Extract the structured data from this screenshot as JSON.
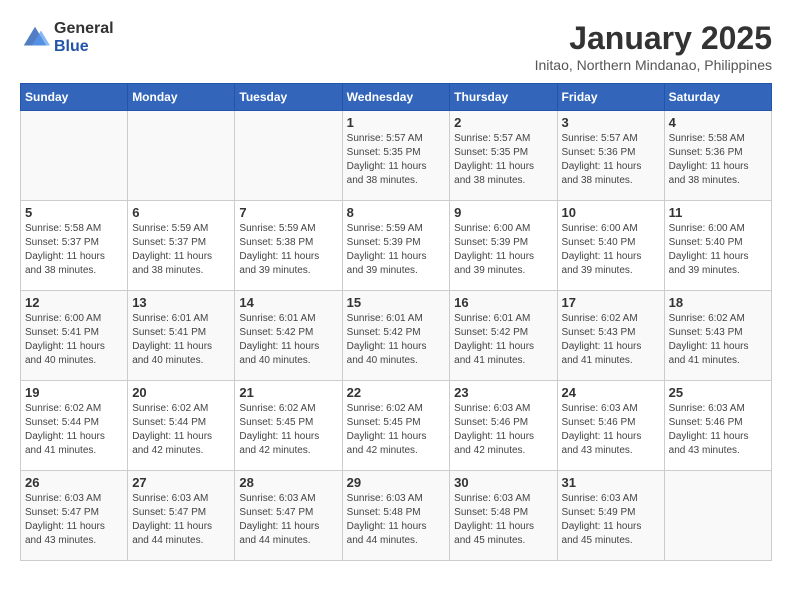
{
  "logo": {
    "general": "General",
    "blue": "Blue"
  },
  "title": "January 2025",
  "subtitle": "Initao, Northern Mindanao, Philippines",
  "days_of_week": [
    "Sunday",
    "Monday",
    "Tuesday",
    "Wednesday",
    "Thursday",
    "Friday",
    "Saturday"
  ],
  "weeks": [
    [
      {
        "day": "",
        "sunrise": "",
        "sunset": "",
        "daylight": ""
      },
      {
        "day": "",
        "sunrise": "",
        "sunset": "",
        "daylight": ""
      },
      {
        "day": "",
        "sunrise": "",
        "sunset": "",
        "daylight": ""
      },
      {
        "day": "1",
        "sunrise": "Sunrise: 5:57 AM",
        "sunset": "Sunset: 5:35 PM",
        "daylight": "Daylight: 11 hours and 38 minutes."
      },
      {
        "day": "2",
        "sunrise": "Sunrise: 5:57 AM",
        "sunset": "Sunset: 5:35 PM",
        "daylight": "Daylight: 11 hours and 38 minutes."
      },
      {
        "day": "3",
        "sunrise": "Sunrise: 5:57 AM",
        "sunset": "Sunset: 5:36 PM",
        "daylight": "Daylight: 11 hours and 38 minutes."
      },
      {
        "day": "4",
        "sunrise": "Sunrise: 5:58 AM",
        "sunset": "Sunset: 5:36 PM",
        "daylight": "Daylight: 11 hours and 38 minutes."
      }
    ],
    [
      {
        "day": "5",
        "sunrise": "Sunrise: 5:58 AM",
        "sunset": "Sunset: 5:37 PM",
        "daylight": "Daylight: 11 hours and 38 minutes."
      },
      {
        "day": "6",
        "sunrise": "Sunrise: 5:59 AM",
        "sunset": "Sunset: 5:37 PM",
        "daylight": "Daylight: 11 hours and 38 minutes."
      },
      {
        "day": "7",
        "sunrise": "Sunrise: 5:59 AM",
        "sunset": "Sunset: 5:38 PM",
        "daylight": "Daylight: 11 hours and 39 minutes."
      },
      {
        "day": "8",
        "sunrise": "Sunrise: 5:59 AM",
        "sunset": "Sunset: 5:39 PM",
        "daylight": "Daylight: 11 hours and 39 minutes."
      },
      {
        "day": "9",
        "sunrise": "Sunrise: 6:00 AM",
        "sunset": "Sunset: 5:39 PM",
        "daylight": "Daylight: 11 hours and 39 minutes."
      },
      {
        "day": "10",
        "sunrise": "Sunrise: 6:00 AM",
        "sunset": "Sunset: 5:40 PM",
        "daylight": "Daylight: 11 hours and 39 minutes."
      },
      {
        "day": "11",
        "sunrise": "Sunrise: 6:00 AM",
        "sunset": "Sunset: 5:40 PM",
        "daylight": "Daylight: 11 hours and 39 minutes."
      }
    ],
    [
      {
        "day": "12",
        "sunrise": "Sunrise: 6:00 AM",
        "sunset": "Sunset: 5:41 PM",
        "daylight": "Daylight: 11 hours and 40 minutes."
      },
      {
        "day": "13",
        "sunrise": "Sunrise: 6:01 AM",
        "sunset": "Sunset: 5:41 PM",
        "daylight": "Daylight: 11 hours and 40 minutes."
      },
      {
        "day": "14",
        "sunrise": "Sunrise: 6:01 AM",
        "sunset": "Sunset: 5:42 PM",
        "daylight": "Daylight: 11 hours and 40 minutes."
      },
      {
        "day": "15",
        "sunrise": "Sunrise: 6:01 AM",
        "sunset": "Sunset: 5:42 PM",
        "daylight": "Daylight: 11 hours and 40 minutes."
      },
      {
        "day": "16",
        "sunrise": "Sunrise: 6:01 AM",
        "sunset": "Sunset: 5:42 PM",
        "daylight": "Daylight: 11 hours and 41 minutes."
      },
      {
        "day": "17",
        "sunrise": "Sunrise: 6:02 AM",
        "sunset": "Sunset: 5:43 PM",
        "daylight": "Daylight: 11 hours and 41 minutes."
      },
      {
        "day": "18",
        "sunrise": "Sunrise: 6:02 AM",
        "sunset": "Sunset: 5:43 PM",
        "daylight": "Daylight: 11 hours and 41 minutes."
      }
    ],
    [
      {
        "day": "19",
        "sunrise": "Sunrise: 6:02 AM",
        "sunset": "Sunset: 5:44 PM",
        "daylight": "Daylight: 11 hours and 41 minutes."
      },
      {
        "day": "20",
        "sunrise": "Sunrise: 6:02 AM",
        "sunset": "Sunset: 5:44 PM",
        "daylight": "Daylight: 11 hours and 42 minutes."
      },
      {
        "day": "21",
        "sunrise": "Sunrise: 6:02 AM",
        "sunset": "Sunset: 5:45 PM",
        "daylight": "Daylight: 11 hours and 42 minutes."
      },
      {
        "day": "22",
        "sunrise": "Sunrise: 6:02 AM",
        "sunset": "Sunset: 5:45 PM",
        "daylight": "Daylight: 11 hours and 42 minutes."
      },
      {
        "day": "23",
        "sunrise": "Sunrise: 6:03 AM",
        "sunset": "Sunset: 5:46 PM",
        "daylight": "Daylight: 11 hours and 42 minutes."
      },
      {
        "day": "24",
        "sunrise": "Sunrise: 6:03 AM",
        "sunset": "Sunset: 5:46 PM",
        "daylight": "Daylight: 11 hours and 43 minutes."
      },
      {
        "day": "25",
        "sunrise": "Sunrise: 6:03 AM",
        "sunset": "Sunset: 5:46 PM",
        "daylight": "Daylight: 11 hours and 43 minutes."
      }
    ],
    [
      {
        "day": "26",
        "sunrise": "Sunrise: 6:03 AM",
        "sunset": "Sunset: 5:47 PM",
        "daylight": "Daylight: 11 hours and 43 minutes."
      },
      {
        "day": "27",
        "sunrise": "Sunrise: 6:03 AM",
        "sunset": "Sunset: 5:47 PM",
        "daylight": "Daylight: 11 hours and 44 minutes."
      },
      {
        "day": "28",
        "sunrise": "Sunrise: 6:03 AM",
        "sunset": "Sunset: 5:47 PM",
        "daylight": "Daylight: 11 hours and 44 minutes."
      },
      {
        "day": "29",
        "sunrise": "Sunrise: 6:03 AM",
        "sunset": "Sunset: 5:48 PM",
        "daylight": "Daylight: 11 hours and 44 minutes."
      },
      {
        "day": "30",
        "sunrise": "Sunrise: 6:03 AM",
        "sunset": "Sunset: 5:48 PM",
        "daylight": "Daylight: 11 hours and 45 minutes."
      },
      {
        "day": "31",
        "sunrise": "Sunrise: 6:03 AM",
        "sunset": "Sunset: 5:49 PM",
        "daylight": "Daylight: 11 hours and 45 minutes."
      },
      {
        "day": "",
        "sunrise": "",
        "sunset": "",
        "daylight": ""
      }
    ]
  ]
}
